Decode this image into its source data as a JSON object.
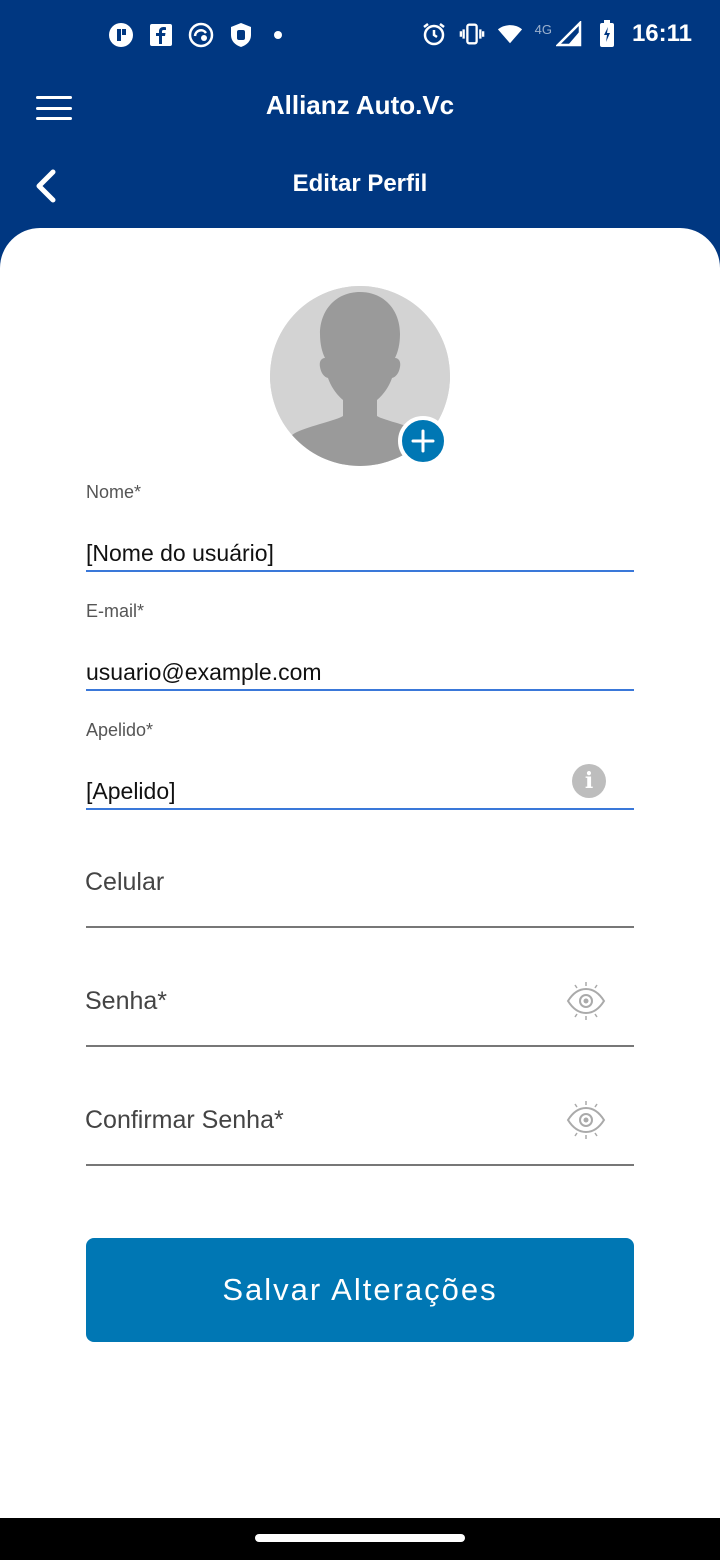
{
  "status_bar": {
    "time": "16:11",
    "network": "4G",
    "left_icons": [
      "app-badge-icon",
      "facebook-icon",
      "sync-app-icon",
      "shield-app-icon"
    ],
    "right_icons": [
      "alarm-icon",
      "vibrate-icon",
      "wifi-icon",
      "cell-signal-icon",
      "battery-charging-icon"
    ]
  },
  "app_bar": {
    "title": "Allianz Auto.Vc"
  },
  "page_bar": {
    "title": "Editar Perfil"
  },
  "form": {
    "name": {
      "label": "Nome*",
      "value": "[Nome do usuário]"
    },
    "email": {
      "label": "E-mail*",
      "value": "usuario@example.com"
    },
    "nickname": {
      "label": "Apelido*",
      "value": "[Apelido]"
    },
    "phone": {
      "placeholder": "Celular"
    },
    "password": {
      "placeholder": "Senha*"
    },
    "confirm_password": {
      "placeholder": "Confirmar Senha*"
    }
  },
  "save_button": {
    "label": "Salvar Alterações"
  },
  "colors": {
    "header": "#003781",
    "accent": "#0077b4",
    "focus_line": "#3a78d9"
  }
}
